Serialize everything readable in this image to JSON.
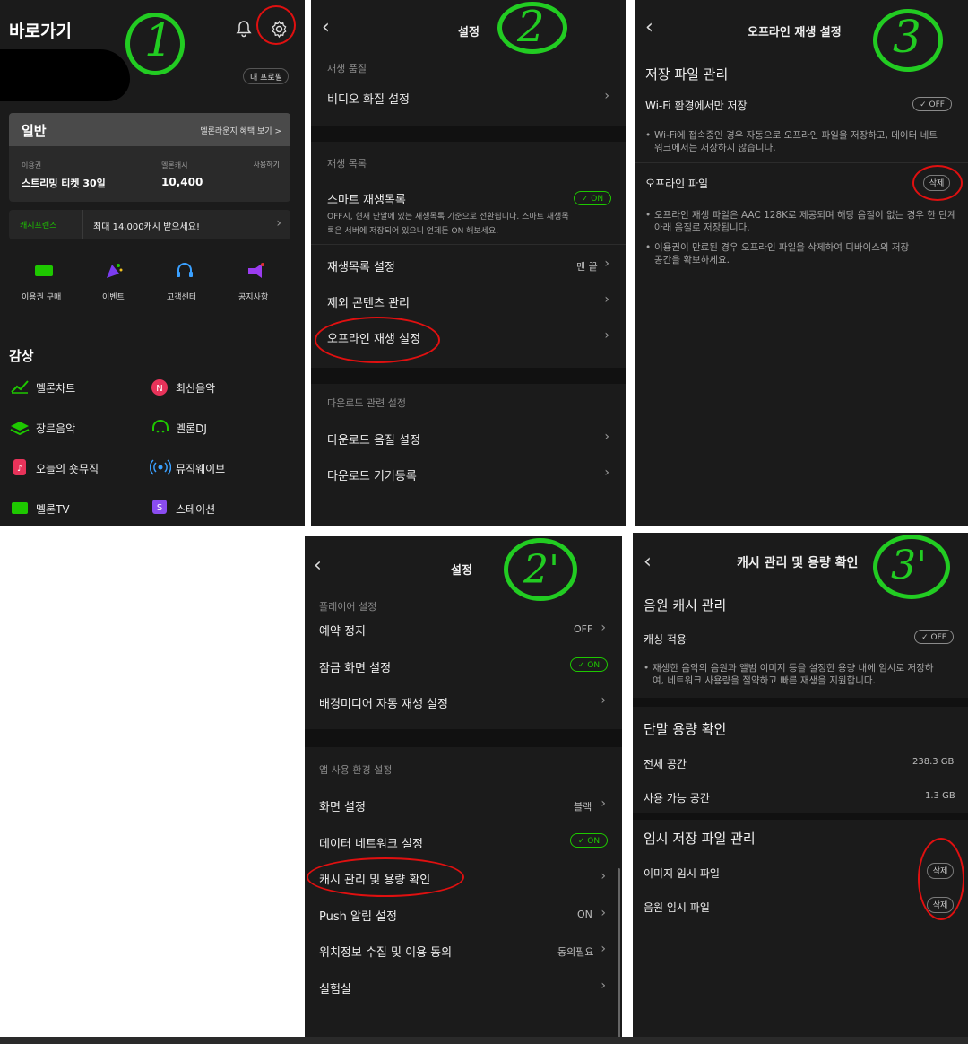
{
  "p1": {
    "title": "바로가기",
    "profile_btn": "내 프로필",
    "membership_label": "일반",
    "membership_link": "멜론라운지 혜택 보기 >",
    "ticket_label": "이용권",
    "ticket_value": "스트리밍 티켓 30일",
    "cash_label": "멜론캐시",
    "cash_value": "10,400",
    "use_label": "사용하기",
    "friends_label": "캐시프렌즈",
    "friends_promo": "최대 14,000캐시 받으세요!",
    "shortcuts": [
      "이용권 구매",
      "이벤트",
      "고객센터",
      "공지사항"
    ],
    "section": "감상",
    "menu": [
      "멜론차트",
      "최신음악",
      "장르음악",
      "멜론DJ",
      "오늘의 숏뮤직",
      "뮤직웨이브",
      "멜론TV",
      "스테이션"
    ]
  },
  "p2": {
    "title": "설정",
    "sec_quality": "재생 품질",
    "video_quality": "비디오 화질 설정",
    "sec_playlist": "재생 목록",
    "smart_playlist": "스마트 재생목록",
    "smart_on": "✓ ON",
    "smart_desc": "OFF시, 현재 단말에 있는 재생목록 기준으로 전환됩니다. 스마트 재생목록은 서버에 저장되어 있으니 언제든 ON 해보세요.",
    "playlist_settings": "재생목록 설정",
    "playlist_value": "맨 끝",
    "exclude_content": "제외 콘텐츠 관리",
    "offline_settings": "오프라인 재생 설정",
    "sec_download": "다운로드 관련 설정",
    "download_quality": "다운로드 음질 설정",
    "download_device": "다운로드 기기등록"
  },
  "p3": {
    "title": "오프라인 재생 설정",
    "storage_mgmt": "저장 파일 관리",
    "wifi_only": "Wi-Fi 환경에서만 저장",
    "wifi_off": "✓ OFF",
    "wifi_desc": "Wi-Fi에 접속중인 경우 자동으로 오프라인 파일을 저장하고, 데이터 네트워크에서는 저장하지 않습니다.",
    "offline_file": "오프라인 파일",
    "delete": "삭제",
    "desc1": "오프라인 재생 파일은 AAC 128K로 제공되며 해당 음질이 없는 경우 한 단계 아래 음질로 저장됩니다.",
    "desc2": "이용권이 만료된 경우 오프라인 파일을 삭제하여 디바이스의 저장공간을 확보하세요."
  },
  "p4": {
    "title": "설정",
    "sec_player": "플레이어 설정",
    "sleep_timer": "예약 정지",
    "sleep_value": "OFF",
    "lock_screen": "잠금 화면 설정",
    "lock_on": "✓ ON",
    "bg_media": "배경미디어 자동 재생 설정",
    "sec_app": "앱 사용 환경 설정",
    "screen": "화면 설정",
    "screen_value": "블랙",
    "data_network": "데이터 네트워크 설정",
    "data_on": "✓ ON",
    "cache_mgmt": "캐시 관리 및 용량 확인",
    "push": "Push 알림 설정",
    "push_value": "ON",
    "location": "위치정보 수집 및 이용 동의",
    "location_value": "동의필요",
    "lab": "실험실"
  },
  "p5": {
    "title": "캐시 관리 및 용량 확인",
    "audio_cache": "음원 캐시 관리",
    "cache_apply": "캐싱 적용",
    "cache_off": "✓ OFF",
    "cache_desc": "재생한 음악의 음원과 앨범 이미지 등을 설정한 용량 내에 임시로 저장하여, 네트워크 사용량을 절약하고 빠른 재생을 지원합니다.",
    "device_capacity": "단말 용량 확인",
    "total_space": "전체 공간",
    "total_value": "238.3 GB",
    "free_space": "사용 가능 공간",
    "free_value": "1.3 GB",
    "temp_mgmt": "임시 저장 파일 관리",
    "image_temp": "이미지 임시 파일",
    "audio_temp": "음원 임시 파일",
    "delete": "삭제"
  },
  "colors": {
    "accent": "#1ec800",
    "bg": "#1b1b1b",
    "annotation_red": "#e01010",
    "annotation_green": "#22cc22"
  }
}
